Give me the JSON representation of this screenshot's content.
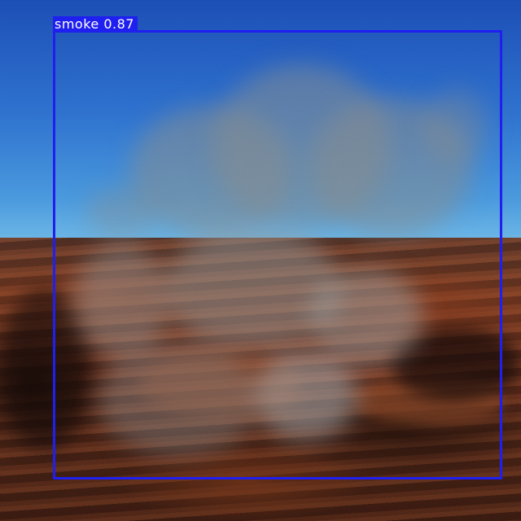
{
  "detection": {
    "label": "smoke 0.87",
    "class_name": "smoke",
    "confidence": 0.87,
    "box_color": "#1f1ff0",
    "label_text_color": "#ffffff"
  }
}
